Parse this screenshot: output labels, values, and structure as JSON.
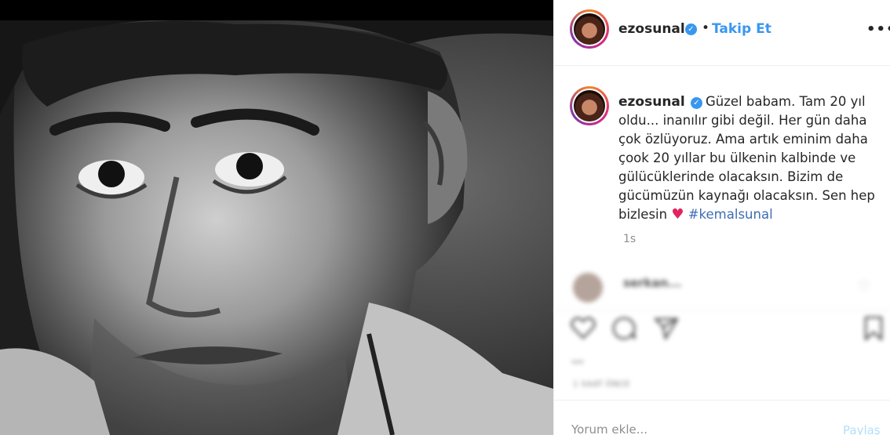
{
  "header": {
    "username": "ezosunal",
    "separator": "•",
    "follow_label": "Takip Et",
    "more_label": "•••"
  },
  "caption": {
    "username": "ezosunal",
    "text": "Güzel babam. Tam 20 yıl oldu... inanılır gibi değil. Her gün daha çok özlüyoruz. Ama artık eminim daha çook 20 yıllar bu ülkenin kalbinde ve gülücüklerinde olacaksın. Bizim de gücümüzün kaynağı olacaksın. Sen hep bizlesin",
    "heart": "♥",
    "hashtag": "#kemalsunal",
    "time": "1s"
  },
  "comment": {
    "username": "serkan..."
  },
  "likes": {
    "text": "..."
  },
  "post_time_label": "1 SAAT ÖNCE",
  "comment_box": {
    "placeholder": "Yorum ekle...",
    "post_label": "Paylaş"
  },
  "icons": {
    "verified": "verified-badge-icon",
    "like": "heart-icon",
    "comment": "comment-bubble-icon",
    "share": "paper-plane-icon",
    "save": "bookmark-icon",
    "more": "ellipsis-icon"
  },
  "colors": {
    "link_blue": "#3897f0",
    "text": "#262626",
    "muted": "#8e8e8e"
  }
}
